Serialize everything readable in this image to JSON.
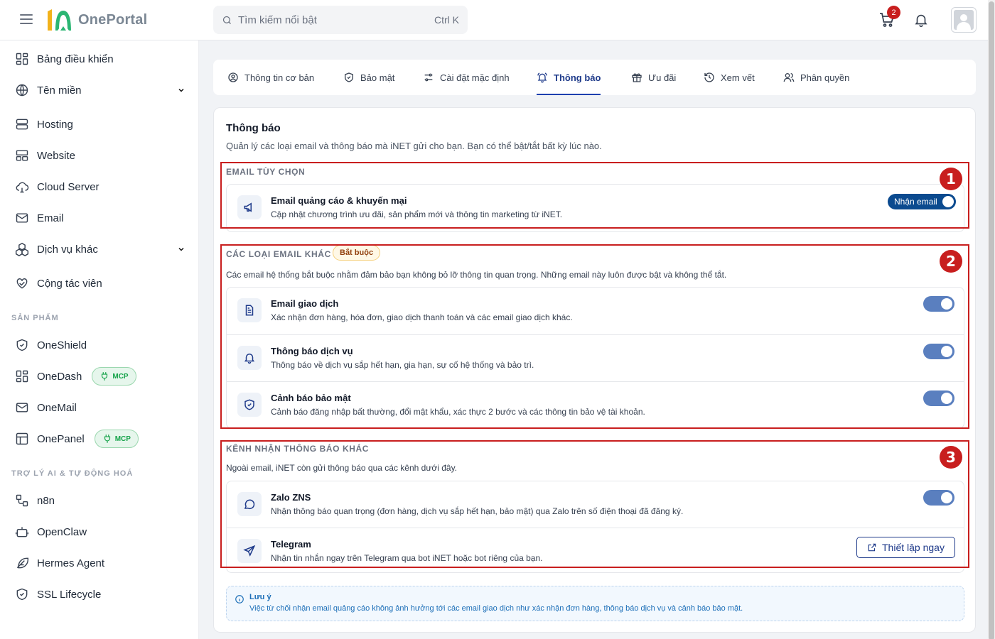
{
  "app": {
    "name": "OnePortal"
  },
  "header": {
    "search_placeholder": "Tìm kiếm nổi bật",
    "search_shortcut": "Ctrl K",
    "cart_count": "2"
  },
  "sidebar": {
    "items": [
      {
        "label": "Bảng điều khiển",
        "icon": "dashboard-icon"
      },
      {
        "label": "Tên miền",
        "icon": "globe-icon",
        "has_chevron": true
      },
      {
        "label": "Hosting",
        "icon": "server-icon"
      },
      {
        "label": "Website",
        "icon": "website-icon"
      },
      {
        "label": "Cloud Server",
        "icon": "cloud-icon"
      },
      {
        "label": "Email",
        "icon": "mail-icon"
      },
      {
        "label": "Dịch vụ khác",
        "icon": "cubes-icon",
        "has_chevron": true
      },
      {
        "label": "Cộng tác viên",
        "icon": "handshake-heart-icon"
      }
    ],
    "section_products": "SẢN PHẨM",
    "products": [
      {
        "label": "OneShield",
        "icon": "shield-icon"
      },
      {
        "label": "OneDash",
        "icon": "dashboard-icon",
        "badge": "MCP"
      },
      {
        "label": "OneMail",
        "icon": "mail-icon"
      },
      {
        "label": "OnePanel",
        "icon": "panel-icon",
        "badge": "MCP"
      }
    ],
    "section_ai": "TRỢ LÝ AI & TỰ ĐỘNG HOÁ",
    "ai_items": [
      {
        "label": "n8n",
        "icon": "workflow-icon"
      },
      {
        "label": "OpenClaw",
        "icon": "robot-icon"
      },
      {
        "label": "Hermes Agent",
        "icon": "feather-icon"
      },
      {
        "label": "SSL Lifecycle",
        "icon": "shield-check-icon"
      }
    ]
  },
  "tabs": [
    {
      "label": "Thông tin cơ bản",
      "icon": "user-circle-icon"
    },
    {
      "label": "Bảo mật",
      "icon": "shield-check-icon"
    },
    {
      "label": "Cài đặt mặc định",
      "icon": "sliders-icon"
    },
    {
      "label": "Thông báo",
      "icon": "bell-ring-icon",
      "active": true
    },
    {
      "label": "Ưu đãi",
      "icon": "gift-icon"
    },
    {
      "label": "Xem vết",
      "icon": "history-icon"
    },
    {
      "label": "Phân quyền",
      "icon": "users-icon"
    }
  ],
  "card": {
    "title": "Thông báo",
    "description": "Quản lý các loại email và thông báo mà iNET gửi cho bạn. Bạn có thể bật/tắt bất kỳ lúc nào."
  },
  "optional_email": {
    "label": "EMAIL TÙY CHỌN",
    "marker": "1",
    "item": {
      "title": "Email quảng cáo & khuyến mại",
      "description": "Cập nhật chương trình ưu đãi, sản phẩm mới và thông tin marketing từ iNET.",
      "toggle_label": "Nhận email",
      "enabled": true,
      "icon": "megaphone-icon"
    }
  },
  "other_emails": {
    "label": "CÁC LOẠI EMAIL KHÁC",
    "badge": "Bắt buộc",
    "marker": "2",
    "description": "Các email hệ thống bắt buộc nhằm đảm bảo bạn không bỏ lỡ thông tin quan trọng. Những email này luôn được bật và không thể tắt.",
    "items": [
      {
        "title": "Email giao dịch",
        "description": "Xác nhận đơn hàng, hóa đơn, giao dịch thanh toán và các email giao dịch khác.",
        "enabled": true,
        "icon": "document-icon"
      },
      {
        "title": "Thông báo dịch vụ",
        "description": "Thông báo về dịch vụ sắp hết hạn, gia hạn, sự cố hệ thống và bảo trì.",
        "enabled": true,
        "icon": "bell-icon"
      },
      {
        "title": "Cảnh báo bảo mật",
        "description": "Cảnh báo đăng nhập bất thường, đổi mật khẩu, xác thực 2 bước và các thông tin bảo vệ tài khoản.",
        "enabled": true,
        "icon": "shield-check-icon"
      }
    ]
  },
  "other_channels": {
    "label": "KÊNH NHẬN THÔNG BÁO KHÁC",
    "marker": "3",
    "description": "Ngoài email, iNET còn gửi thông báo qua các kênh dưới đây.",
    "items": [
      {
        "title": "Zalo ZNS",
        "description": "Nhận thông báo quan trọng (đơn hàng, dịch vụ sắp hết hạn, bảo mật) qua Zalo trên số điện thoại đã đăng ký.",
        "enabled": true,
        "icon": "chat-icon"
      },
      {
        "title": "Telegram",
        "description": "Nhận tin nhắn ngay trên Telegram qua bot iNET hoặc bot riêng của bạn.",
        "button_label": "Thiết lập ngay",
        "icon": "send-icon"
      }
    ]
  },
  "note": {
    "title": "Lưu ý",
    "description": "Việc từ chối nhận email quảng cáo không ảnh hưởng tới các email giao dịch như xác nhận đơn hàng, thông báo dịch vụ và cảnh báo bảo mật."
  },
  "colors": {
    "primary": "#1e3a8a",
    "toggle_on": "#5a7fbf",
    "annotation_red": "#c81e1e",
    "mcp_green": "#16a34a"
  }
}
